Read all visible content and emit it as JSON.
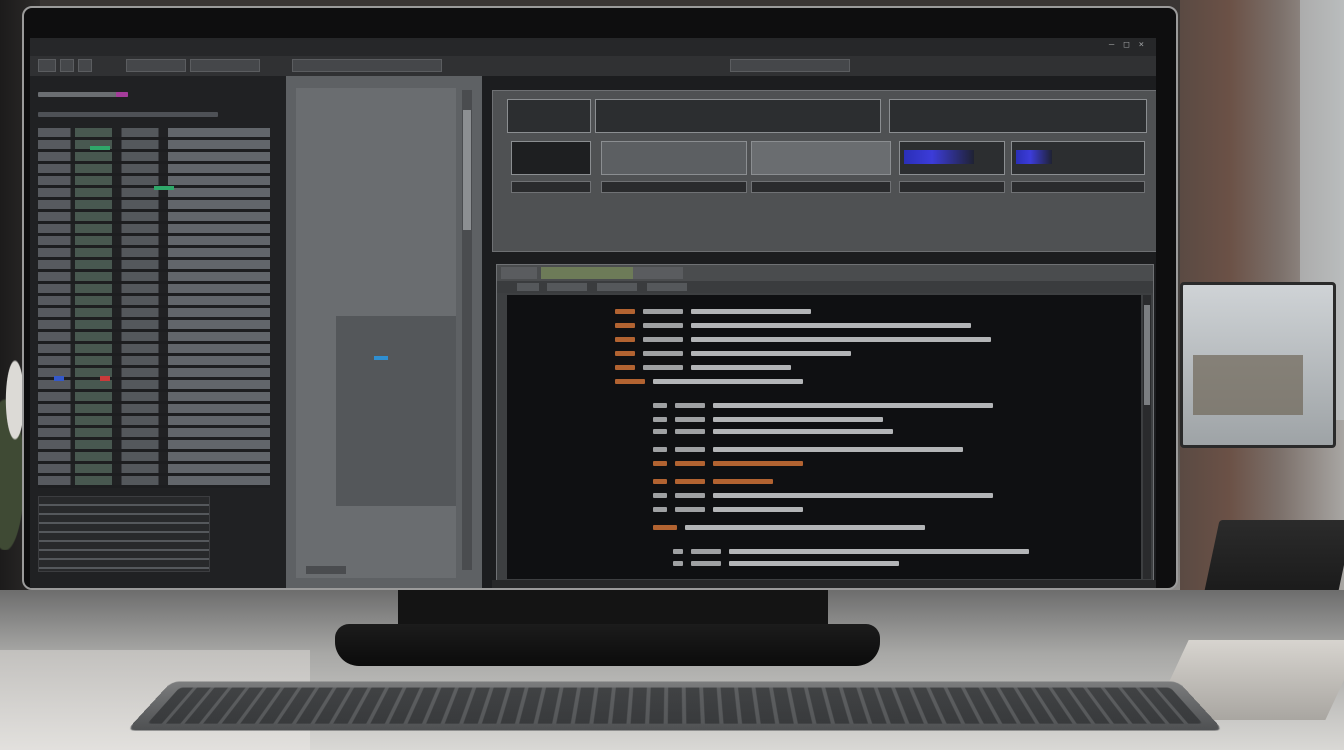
{
  "window": {
    "title": "",
    "controls": "— □ ×"
  },
  "toolbar": {
    "buttons": [
      "",
      "",
      "",
      "",
      "",
      "",
      ""
    ]
  },
  "tree": {
    "items": []
  },
  "preview": {
    "labels": []
  },
  "editor": {
    "tabs": [],
    "lines": [
      {
        "num": "",
        "code": ""
      }
    ],
    "status": ""
  },
  "statusbar": {
    "text": ""
  },
  "colors": {
    "accent_orange": "#e07b3a",
    "accent_blue": "#3c3cd9",
    "accent_green": "#6d7b58",
    "accent_magenta": "#a43c9a"
  }
}
